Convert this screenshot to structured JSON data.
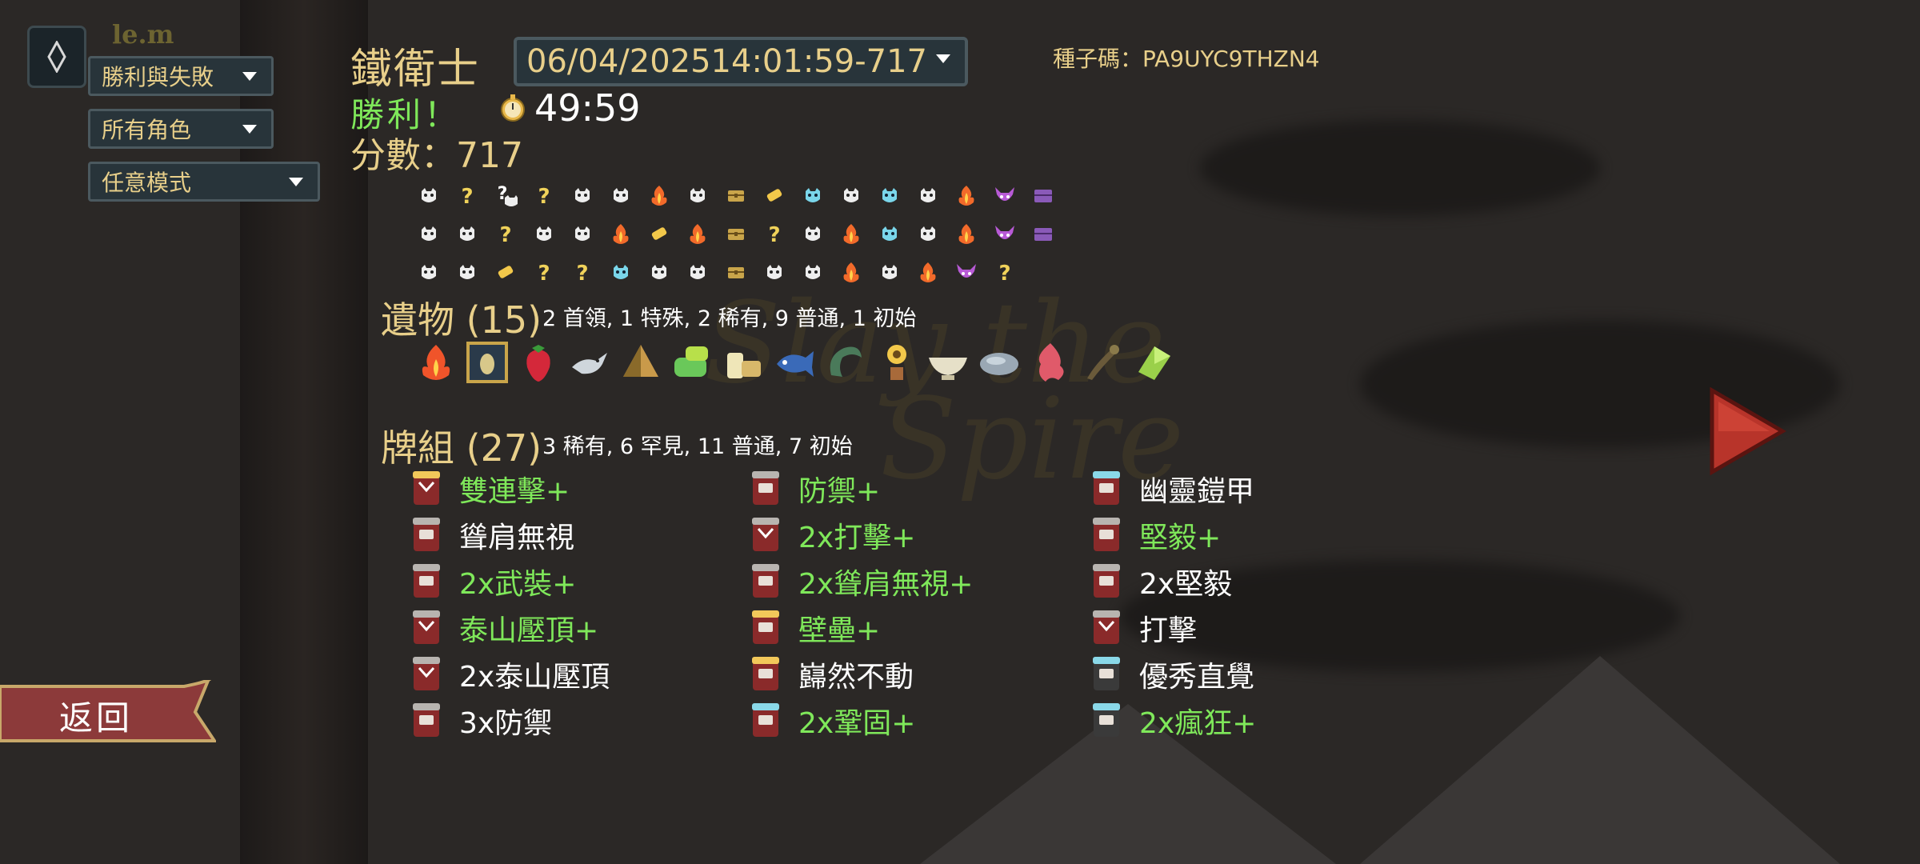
{
  "user_tag": "le.m",
  "filters": {
    "result": "勝利與失敗",
    "character": "所有角色",
    "mode": "任意模式"
  },
  "run": {
    "character": "鐵衛士",
    "date": "06/04/202514:01:59-717",
    "seed": "種子碼：PA9UYC9THZN4",
    "result": "勝利！",
    "time": "49:59",
    "score": "分數：717"
  },
  "path": [
    [
      "monster",
      "unknown",
      "unknown-monster",
      "unknown",
      "monster",
      "monster",
      "elite",
      "monster",
      "chest",
      "shop",
      "blue",
      "monster",
      "blue",
      "monster",
      "elite",
      "boss",
      "boss-chest"
    ],
    [
      "monster",
      "monster",
      "unknown",
      "monster",
      "monster",
      "elite",
      "shop",
      "elite",
      "chest",
      "unknown",
      "monster",
      "elite",
      "blue",
      "monster",
      "elite",
      "boss",
      "boss-chest"
    ],
    [
      "monster",
      "monster",
      "shop",
      "unknown",
      "unknown",
      "blue",
      "monster",
      "monster",
      "chest",
      "monster",
      "monster",
      "elite",
      "monster",
      "elite",
      "boss",
      "unknown"
    ]
  ],
  "relics": {
    "title": "遺物",
    "count": "(15)",
    "summary": "2 首領, 1 特殊, 2 稀有, 9 普通, 1 初始",
    "items": [
      "burning-blood",
      "beetle-frame",
      "strawberry",
      "bird",
      "pyramid",
      "toolkit",
      "bread",
      "fish",
      "horn",
      "sunflower",
      "bowl",
      "stone",
      "flame-creature",
      "pipe",
      "crystal"
    ]
  },
  "deck": {
    "title": "牌組",
    "count": "(27)",
    "summary": "3 稀有, 6 罕見, 11 普通, 7 初始",
    "columns": [
      [
        {
          "name": "雙連擊+",
          "upgraded": true,
          "type": "attack",
          "rarity": "gold"
        },
        {
          "name": "聳肩無視",
          "upgraded": false,
          "type": "skill",
          "rarity": "grey"
        },
        {
          "name": "2x武裝+",
          "upgraded": true,
          "type": "skill",
          "rarity": "grey"
        },
        {
          "name": "泰山壓頂+",
          "upgraded": true,
          "type": "attack",
          "rarity": "grey"
        },
        {
          "name": "2x泰山壓頂",
          "upgraded": false,
          "type": "attack",
          "rarity": "grey"
        },
        {
          "name": "3x防禦",
          "upgraded": false,
          "type": "skill",
          "rarity": "grey"
        }
      ],
      [
        {
          "name": "防禦+",
          "upgraded": true,
          "type": "skill",
          "rarity": "grey"
        },
        {
          "name": "2x打擊+",
          "upgraded": true,
          "type": "attack",
          "rarity": "grey"
        },
        {
          "name": "2x聳肩無視+",
          "upgraded": true,
          "type": "skill",
          "rarity": "grey"
        },
        {
          "name": "壁壘+",
          "upgraded": true,
          "type": "skill",
          "rarity": "gold"
        },
        {
          "name": "巋然不動",
          "upgraded": false,
          "type": "skill",
          "rarity": "gold"
        },
        {
          "name": "2x鞏固+",
          "upgraded": true,
          "type": "skill",
          "rarity": "blue"
        }
      ],
      [
        {
          "name": "幽靈鎧甲",
          "upgraded": false,
          "type": "skill",
          "rarity": "blue"
        },
        {
          "name": "堅毅+",
          "upgraded": true,
          "type": "skill",
          "rarity": "grey"
        },
        {
          "name": "2x堅毅",
          "upgraded": false,
          "type": "skill",
          "rarity": "grey"
        },
        {
          "name": "打擊",
          "upgraded": false,
          "type": "attack",
          "rarity": "grey"
        },
        {
          "name": "優秀直覺",
          "upgraded": false,
          "type": "skill-colorless",
          "rarity": "blue"
        },
        {
          "name": "2x瘋狂+",
          "upgraded": true,
          "type": "skill-colorless",
          "rarity": "blue"
        }
      ]
    ]
  },
  "back_label": "返回",
  "watermark": [
    "Slay the",
    "Spire"
  ],
  "colors": {
    "gold": "#e8cf8a",
    "green": "#7fe85a",
    "panel": "#28343a",
    "border": "#4b595f"
  }
}
